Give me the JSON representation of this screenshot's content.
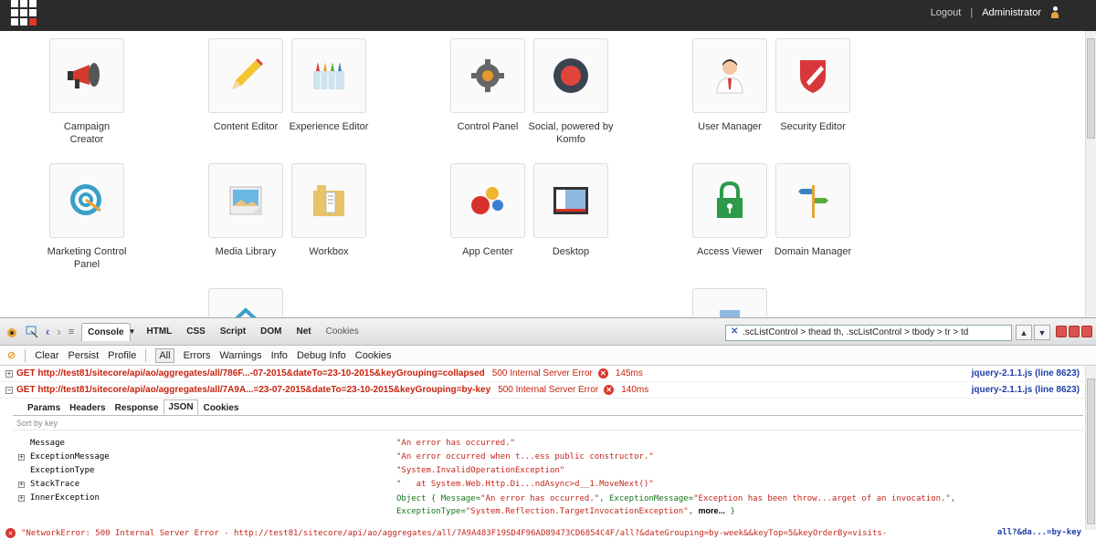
{
  "header": {
    "logout": "Logout",
    "separator": "|",
    "user": "Administrator"
  },
  "tiles": [
    {
      "label": "Campaign\nCreator",
      "icon": "megaphone-icon"
    },
    {
      "label": "Content Editor",
      "icon": "pencil-icon"
    },
    {
      "label": "Experience Editor",
      "icon": "crayons-icon"
    },
    {
      "label": "Control Panel",
      "icon": "gear-icon"
    },
    {
      "label": "Social, powered by Komfo",
      "icon": "komfo-icon"
    },
    {
      "label": "User Manager",
      "icon": "user-icon"
    },
    {
      "label": "Security Editor",
      "icon": "shield-icon"
    },
    {
      "label": "Marketing Control Panel",
      "icon": "target-icon"
    },
    {
      "label": "Media Library",
      "icon": "image-icon"
    },
    {
      "label": "Workbox",
      "icon": "folder-icon"
    },
    {
      "label": "App Center",
      "icon": "app-center-icon"
    },
    {
      "label": "Desktop",
      "icon": "desktop-icon"
    },
    {
      "label": "Access Viewer",
      "icon": "lock-icon"
    },
    {
      "label": "Domain Manager",
      "icon": "signpost-icon"
    }
  ],
  "firebug": {
    "tabs": [
      "Console",
      "HTML",
      "CSS",
      "Script",
      "DOM",
      "Net",
      "Cookies"
    ],
    "search_value": ".scListControl > thead th, .scListControl > tbody > tr > td",
    "console_buttons": [
      "Clear",
      "Persist",
      "Profile"
    ],
    "filters": [
      "All",
      "Errors",
      "Warnings",
      "Info",
      "Debug Info",
      "Cookies"
    ],
    "requests": [
      {
        "toggle": "+",
        "url": "GET http://test81/sitecore/api/ao/aggregates/all/786F...-07-2015&dateTo=23-10-2015&keyGrouping=collapsed",
        "status": "500 Internal Server Error",
        "time": "145ms",
        "source": "jquery-2.1.1.js (line 8623)"
      },
      {
        "toggle": "−",
        "url": "GET http://test81/sitecore/api/ao/aggregates/all/7A9A...=23-07-2015&dateTo=23-10-2015&keyGrouping=by-key",
        "status": "500 Internal Server Error",
        "time": "140ms",
        "source": "jquery-2.1.1.js (line 8623)"
      }
    ],
    "detail_tabs": [
      "Params",
      "Headers",
      "Response",
      "JSON",
      "Cookies"
    ],
    "sort_label": "Sort by key",
    "json_rows": [
      {
        "key": "Message",
        "expandable": false,
        "value": "\"An error has occurred.\""
      },
      {
        "key": "ExceptionMessage",
        "expandable": true,
        "value": "\"An error occurred when t...ess public constructor.\""
      },
      {
        "key": "ExceptionType",
        "expandable": false,
        "value": "\"System.InvalidOperationException\""
      },
      {
        "key": "StackTrace",
        "expandable": true,
        "value": "\"   at System.Web.Http.Di...ndAsync>d__1.MoveNext()\""
      },
      {
        "key": "InnerException",
        "expandable": true,
        "value": ""
      }
    ],
    "inner_exception": {
      "line1_prefix": "Object { Message=",
      "line1_msg": "\"An error has occurred.\"",
      "line1_mid": ", ExceptionMessage=",
      "line1_exc": "\"Exception has been throw...arget of an invocation.\"",
      "line1_end": ",",
      "line2_prefix": "ExceptionType=",
      "line2_type": "\"System.Reflection.TargetInvocationException\"",
      "line2_sep": ", ",
      "more": "more...",
      "close": " }"
    },
    "network_error": "\"NetworkError: 500 Internal Server Error - http://test81/sitecore/api/ao/aggregates/all/7A9A483F19SD4F96AD89473CD6854C4F/all?&dateGrouping=by-week&&keyTop=5&keyOrderBy=visits-",
    "network_error_tail": "all?&da...=by-key"
  }
}
